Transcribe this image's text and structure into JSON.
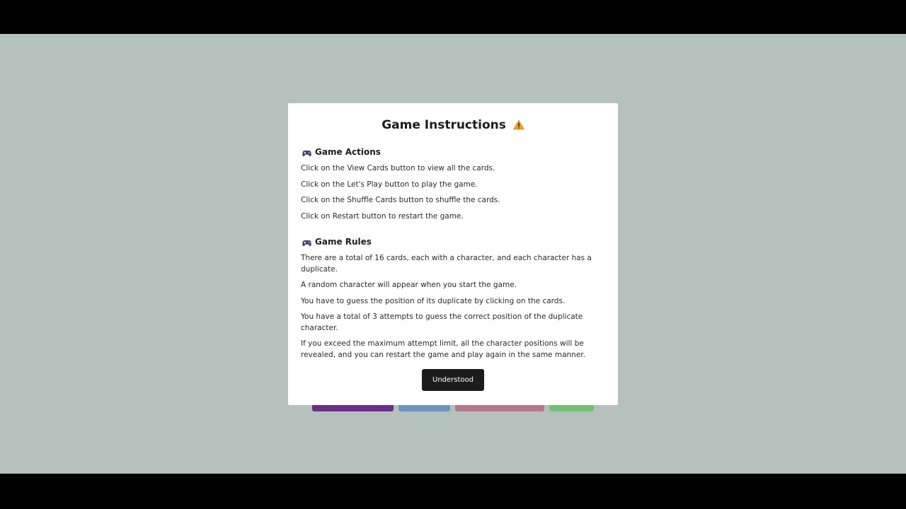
{
  "modal": {
    "title": "Game Instructions",
    "title_icon": "warning-icon",
    "actions": {
      "heading": "Game Actions",
      "icon": "gamepad-icon",
      "items": [
        "Click on the View Cards button to view all the cards.",
        "Click on the Let's Play button to play the game.",
        "Click on the Shuffle Cards button to shuffle the cards.",
        "Click on Restart button to restart the game."
      ]
    },
    "rules": {
      "heading": "Game Rules",
      "icon": "gamepad-icon",
      "items": [
        "There are a total of 16 cards, each with a character, and each character has a duplicate.",
        "A random character will appear when you start the game.",
        "You have to guess the position of its duplicate by clicking on the cards.",
        "You have a total of 3 attempts to guess the correct position of the duplicate character.",
        "If you exceed the maximum attempt limit, all the character positions will be revealed, and you can restart the game and play again in the same manner."
      ]
    },
    "button_label": "Understood"
  },
  "background_buttons": [
    {
      "color": "#6a2d8a"
    },
    {
      "color": "#6a96bd"
    },
    {
      "color": "#b8768a"
    },
    {
      "color": "#72bf72"
    }
  ],
  "colors": {
    "page_background": "#b5c1bd",
    "modal_background": "#ffffff",
    "button_background": "#1c1c1c",
    "icon_purple": "#4a3a6a",
    "warning_amber": "#f0a020"
  }
}
